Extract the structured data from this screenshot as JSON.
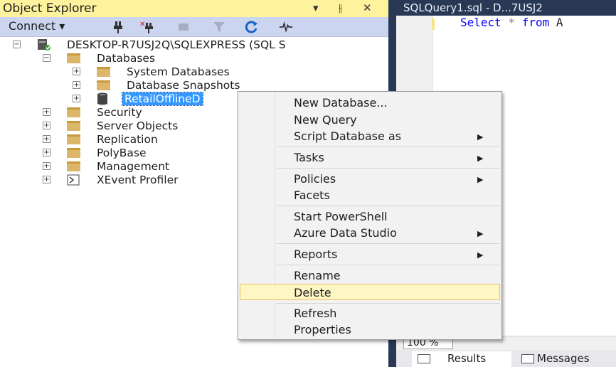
{
  "object_explorer": {
    "title": "Object Explorer",
    "pin_glyph": "▾",
    "autohide_glyph": "⫲",
    "close_glyph": "✕",
    "toolbar": {
      "connect_label": "Connect ▾"
    }
  },
  "tree": {
    "server": "DESKTOP-R7USJ2Q\\SQLEXPRESS (SQL S",
    "databases": "Databases",
    "system_databases": "System Databases",
    "database_snapshots": "Database Snapshots",
    "retail_db": "RetailOfflineD",
    "security": "Security",
    "server_objects": "Server Objects",
    "replication": "Replication",
    "polybase": "PolyBase",
    "management": "Management",
    "xevent_profiler": "XEvent Profiler"
  },
  "editor": {
    "tab_title": "SQLQuery1.sql - D...7USJ2",
    "kw_select": "Select",
    "star": "*",
    "kw_from": "from",
    "tail": "A"
  },
  "zoom": {
    "value": "100 %"
  },
  "results_tabs": {
    "results": "Results",
    "messages": "Messages"
  },
  "context_menu": {
    "new_database": "New Database...",
    "new_query": "New Query",
    "script_database_as": "Script Database as",
    "tasks": "Tasks",
    "policies": "Policies",
    "facets": "Facets",
    "start_powershell": "Start PowerShell",
    "azure_data_studio": "Azure Data Studio",
    "reports": "Reports",
    "rename": "Rename",
    "delete": "Delete",
    "refresh": "Refresh",
    "properties": "Properties",
    "submenu_arrow": "▶"
  },
  "colors": {
    "title_bar": "#fff29d",
    "toolbar": "#ccd5f0",
    "selection": "#3399ff",
    "menu_highlight": "#fef7c4",
    "keyword": "#0000ff"
  }
}
